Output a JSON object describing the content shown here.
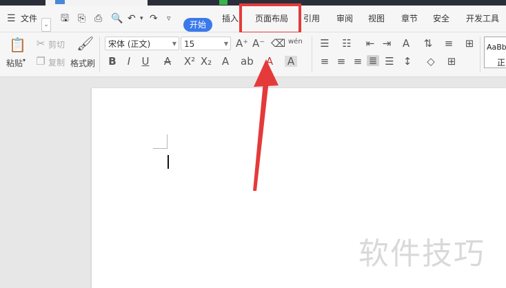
{
  "menubar": {
    "file_label": "文件",
    "tabs": [
      {
        "label": "开始"
      },
      {
        "label": "插入"
      },
      {
        "label": "页面布局"
      },
      {
        "label": "引用"
      },
      {
        "label": "审阅"
      },
      {
        "label": "视图"
      },
      {
        "label": "章节"
      },
      {
        "label": "安全"
      },
      {
        "label": "开发工具"
      }
    ]
  },
  "ribbon": {
    "paste_label": "粘贴",
    "cut_label": "剪切",
    "copy_label": "复制",
    "format_painter_label": "格式刷",
    "font_name": "宋体 (正文)",
    "font_size": "15",
    "style_preview_top": "AaBb",
    "style_preview_bottom": "正"
  },
  "watermark": "软件技巧",
  "colors": {
    "accent": "#3a79ea",
    "highlight": "#e53a3a",
    "arrow": "#e53a3a"
  }
}
